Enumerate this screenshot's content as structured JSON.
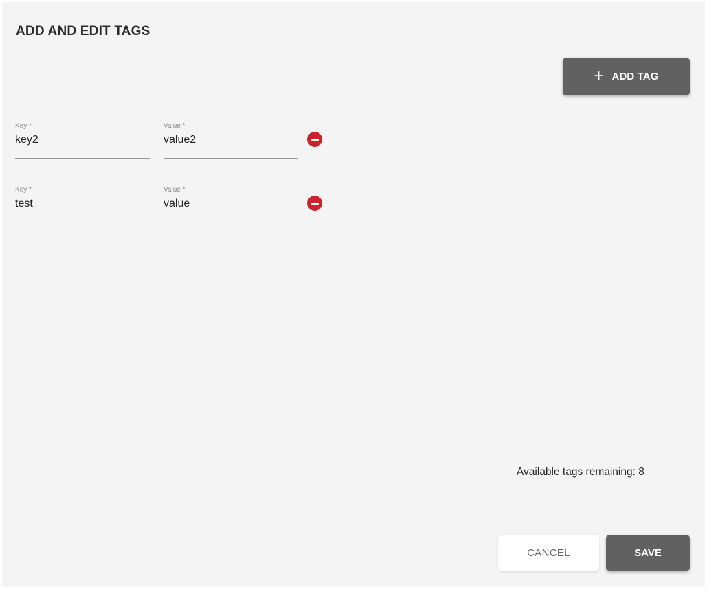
{
  "dialog": {
    "title": "ADD AND EDIT TAGS"
  },
  "add_tag_button": {
    "icon": "plus-icon",
    "label": "ADD TAG"
  },
  "tags": [
    {
      "key_label": "Key *",
      "key_value": "key2",
      "value_label": "Value *",
      "value_value": "value2",
      "remove_icon": "remove-circle-icon"
    },
    {
      "key_label": "Key *",
      "key_value": "test",
      "value_label": "Value *",
      "value_value": "value",
      "remove_icon": "remove-circle-icon"
    }
  ],
  "footer": {
    "remaining_text": "Available tags remaining: 8",
    "cancel_label": "CANCEL",
    "save_label": "SAVE"
  },
  "colors": {
    "background": "#f4f4f4",
    "primary_button": "#616161",
    "remove_icon": "#d0202a"
  }
}
